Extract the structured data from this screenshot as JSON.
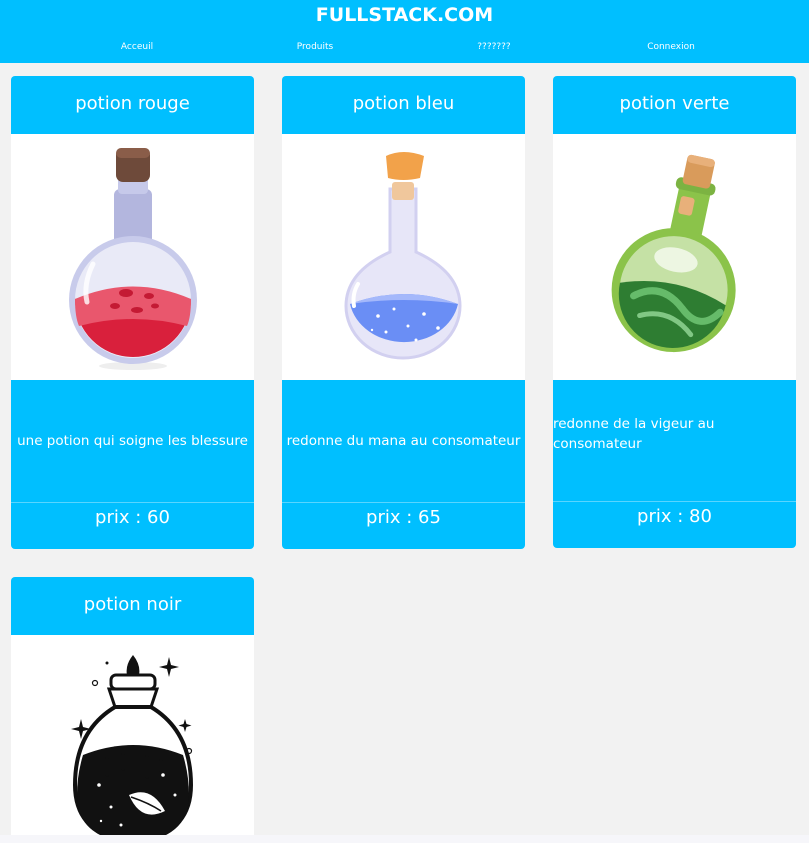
{
  "header": {
    "brand": "FULLSTACK.COM",
    "nav": [
      {
        "label": "Acceuil"
      },
      {
        "label": "Produits"
      },
      {
        "label": "???????"
      },
      {
        "label": "Connexion"
      }
    ]
  },
  "products": [
    {
      "title": "potion rouge",
      "description": "une potion qui soigne les blessure",
      "price": "prix : 60",
      "color": "#d9203c"
    },
    {
      "title": "potion bleu",
      "description": "redonne du mana au consomateur",
      "price": "prix : 65",
      "color": "#6a8ef5"
    },
    {
      "title": "potion verte",
      "description": "redonne de la vigeur au consomateur",
      "price": "prix : 80",
      "color": "#3fa83a"
    },
    {
      "title": "potion noir",
      "color": "#000000"
    }
  ],
  "colors": {
    "accent": "#00bfff",
    "background": "#f2f2f2"
  }
}
